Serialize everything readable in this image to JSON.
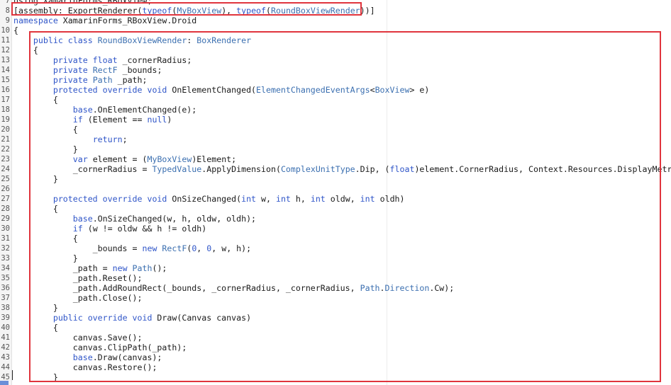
{
  "editor": {
    "lines": [
      {
        "n": "7",
        "segs": [
          {
            "t": "using XamarinForms_RBoxView;",
            "c": ""
          }
        ]
      },
      {
        "n": "8",
        "segs": [
          {
            "t": "[assembly: ExportRenderer(",
            "c": ""
          },
          {
            "t": "typeof",
            "c": "kw"
          },
          {
            "t": "(",
            "c": ""
          },
          {
            "t": "MyBoxView",
            "c": "ty"
          },
          {
            "t": "), ",
            "c": ""
          },
          {
            "t": "typeof",
            "c": "kw"
          },
          {
            "t": "(",
            "c": ""
          },
          {
            "t": "RoundBoxViewRender",
            "c": "ty"
          },
          {
            "t": "))]",
            "c": ""
          }
        ]
      },
      {
        "n": "9",
        "segs": [
          {
            "t": "namespace",
            "c": "kw"
          },
          {
            "t": " XamarinForms_RBoxView.Droid",
            "c": ""
          }
        ]
      },
      {
        "n": "10",
        "segs": [
          {
            "t": "{",
            "c": ""
          }
        ]
      },
      {
        "n": "11",
        "segs": [
          {
            "t": "    ",
            "c": ""
          },
          {
            "t": "public class",
            "c": "kw"
          },
          {
            "t": " ",
            "c": ""
          },
          {
            "t": "RoundBoxViewRender",
            "c": "ty"
          },
          {
            "t": ": ",
            "c": ""
          },
          {
            "t": "BoxRenderer",
            "c": "ty"
          }
        ]
      },
      {
        "n": "12",
        "segs": [
          {
            "t": "    {",
            "c": ""
          }
        ]
      },
      {
        "n": "13",
        "segs": [
          {
            "t": "        ",
            "c": ""
          },
          {
            "t": "private float",
            "c": "kw"
          },
          {
            "t": " _cornerRadius;",
            "c": ""
          }
        ]
      },
      {
        "n": "14",
        "segs": [
          {
            "t": "        ",
            "c": ""
          },
          {
            "t": "private",
            "c": "kw"
          },
          {
            "t": " ",
            "c": ""
          },
          {
            "t": "RectF",
            "c": "ty"
          },
          {
            "t": " _bounds;",
            "c": ""
          }
        ]
      },
      {
        "n": "15",
        "segs": [
          {
            "t": "        ",
            "c": ""
          },
          {
            "t": "private",
            "c": "kw"
          },
          {
            "t": " ",
            "c": ""
          },
          {
            "t": "Path",
            "c": "ty"
          },
          {
            "t": " _path;",
            "c": ""
          }
        ]
      },
      {
        "n": "16",
        "segs": [
          {
            "t": "        ",
            "c": ""
          },
          {
            "t": "protected override void",
            "c": "kw"
          },
          {
            "t": " OnElementChanged(",
            "c": ""
          },
          {
            "t": "ElementChangedEventArgs",
            "c": "ty"
          },
          {
            "t": "<",
            "c": ""
          },
          {
            "t": "BoxView",
            "c": "ty"
          },
          {
            "t": "> e)",
            "c": ""
          }
        ]
      },
      {
        "n": "17",
        "segs": [
          {
            "t": "        {",
            "c": ""
          }
        ]
      },
      {
        "n": "18",
        "segs": [
          {
            "t": "            ",
            "c": ""
          },
          {
            "t": "base",
            "c": "kw"
          },
          {
            "t": ".OnElementChanged(e);",
            "c": ""
          }
        ]
      },
      {
        "n": "19",
        "segs": [
          {
            "t": "            ",
            "c": ""
          },
          {
            "t": "if",
            "c": "kw"
          },
          {
            "t": " (Element == ",
            "c": ""
          },
          {
            "t": "null",
            "c": "kw"
          },
          {
            "t": ")",
            "c": ""
          }
        ]
      },
      {
        "n": "20",
        "segs": [
          {
            "t": "            {",
            "c": ""
          }
        ]
      },
      {
        "n": "21",
        "segs": [
          {
            "t": "                ",
            "c": ""
          },
          {
            "t": "return",
            "c": "kw"
          },
          {
            "t": ";",
            "c": ""
          }
        ]
      },
      {
        "n": "22",
        "segs": [
          {
            "t": "            }",
            "c": ""
          }
        ]
      },
      {
        "n": "23",
        "segs": [
          {
            "t": "            ",
            "c": ""
          },
          {
            "t": "var",
            "c": "kw"
          },
          {
            "t": " element = (",
            "c": ""
          },
          {
            "t": "MyBoxView",
            "c": "ty"
          },
          {
            "t": ")Element;",
            "c": ""
          }
        ]
      },
      {
        "n": "24",
        "segs": [
          {
            "t": "            _cornerRadius = ",
            "c": ""
          },
          {
            "t": "TypedValue",
            "c": "ty"
          },
          {
            "t": ".ApplyDimension(",
            "c": ""
          },
          {
            "t": "ComplexUnitType",
            "c": "ty"
          },
          {
            "t": ".Dip, (",
            "c": ""
          },
          {
            "t": "float",
            "c": "kw"
          },
          {
            "t": ")element.CornerRadius, Context.Resources.DisplayMetrics);",
            "c": ""
          }
        ]
      },
      {
        "n": "25",
        "segs": [
          {
            "t": "        }",
            "c": ""
          }
        ]
      },
      {
        "n": "26",
        "segs": [
          {
            "t": "",
            "c": ""
          }
        ]
      },
      {
        "n": "27",
        "segs": [
          {
            "t": "        ",
            "c": ""
          },
          {
            "t": "protected override void",
            "c": "kw"
          },
          {
            "t": " OnSizeChanged(",
            "c": ""
          },
          {
            "t": "int",
            "c": "kw"
          },
          {
            "t": " w, ",
            "c": ""
          },
          {
            "t": "int",
            "c": "kw"
          },
          {
            "t": " h, ",
            "c": ""
          },
          {
            "t": "int",
            "c": "kw"
          },
          {
            "t": " oldw, ",
            "c": ""
          },
          {
            "t": "int",
            "c": "kw"
          },
          {
            "t": " oldh)",
            "c": ""
          }
        ]
      },
      {
        "n": "28",
        "segs": [
          {
            "t": "        {",
            "c": ""
          }
        ]
      },
      {
        "n": "29",
        "segs": [
          {
            "t": "            ",
            "c": ""
          },
          {
            "t": "base",
            "c": "kw"
          },
          {
            "t": ".OnSizeChanged(w, h, oldw, oldh);",
            "c": ""
          }
        ]
      },
      {
        "n": "30",
        "segs": [
          {
            "t": "            ",
            "c": ""
          },
          {
            "t": "if",
            "c": "kw"
          },
          {
            "t": " (w != oldw && h != oldh)",
            "c": ""
          }
        ]
      },
      {
        "n": "31",
        "segs": [
          {
            "t": "            {",
            "c": ""
          }
        ]
      },
      {
        "n": "32",
        "segs": [
          {
            "t": "                _bounds = ",
            "c": ""
          },
          {
            "t": "new",
            "c": "kw"
          },
          {
            "t": " ",
            "c": ""
          },
          {
            "t": "RectF",
            "c": "ty"
          },
          {
            "t": "(",
            "c": ""
          },
          {
            "t": "0",
            "c": "num"
          },
          {
            "t": ", ",
            "c": ""
          },
          {
            "t": "0",
            "c": "num"
          },
          {
            "t": ", w, h);",
            "c": ""
          }
        ]
      },
      {
        "n": "33",
        "segs": [
          {
            "t": "            }",
            "c": ""
          }
        ]
      },
      {
        "n": "34",
        "segs": [
          {
            "t": "            _path = ",
            "c": ""
          },
          {
            "t": "new",
            "c": "kw"
          },
          {
            "t": " ",
            "c": ""
          },
          {
            "t": "Path",
            "c": "ty"
          },
          {
            "t": "();",
            "c": ""
          }
        ]
      },
      {
        "n": "35",
        "segs": [
          {
            "t": "            _path.Reset();",
            "c": ""
          }
        ]
      },
      {
        "n": "36",
        "segs": [
          {
            "t": "            _path.AddRoundRect(_bounds, _cornerRadius, _cornerRadius, ",
            "c": ""
          },
          {
            "t": "Path",
            "c": "ty"
          },
          {
            "t": ".",
            "c": ""
          },
          {
            "t": "Direction",
            "c": "ty"
          },
          {
            "t": ".Cw);",
            "c": ""
          }
        ]
      },
      {
        "n": "37",
        "segs": [
          {
            "t": "            _path.Close();",
            "c": ""
          }
        ]
      },
      {
        "n": "38",
        "segs": [
          {
            "t": "        }",
            "c": ""
          }
        ]
      },
      {
        "n": "39",
        "segs": [
          {
            "t": "        ",
            "c": ""
          },
          {
            "t": "public override void",
            "c": "kw"
          },
          {
            "t": " Draw(Canvas canvas)",
            "c": ""
          }
        ]
      },
      {
        "n": "40",
        "segs": [
          {
            "t": "        {",
            "c": ""
          }
        ]
      },
      {
        "n": "41",
        "segs": [
          {
            "t": "            canvas.Save();",
            "c": ""
          }
        ]
      },
      {
        "n": "42",
        "segs": [
          {
            "t": "            canvas.ClipPath(_path);",
            "c": ""
          }
        ]
      },
      {
        "n": "43",
        "segs": [
          {
            "t": "            ",
            "c": ""
          },
          {
            "t": "base",
            "c": "kw"
          },
          {
            "t": ".Draw(canvas);",
            "c": ""
          }
        ]
      },
      {
        "n": "44",
        "segs": [
          {
            "t": "            canvas.Restore();",
            "c": ""
          }
        ]
      },
      {
        "n": "45",
        "segs": [
          {
            "t": "        }",
            "c": ""
          }
        ]
      }
    ]
  },
  "colors": {
    "keyword": "#2f55c8",
    "type": "#3b6fb0",
    "highlight_box": "#e0343d"
  }
}
